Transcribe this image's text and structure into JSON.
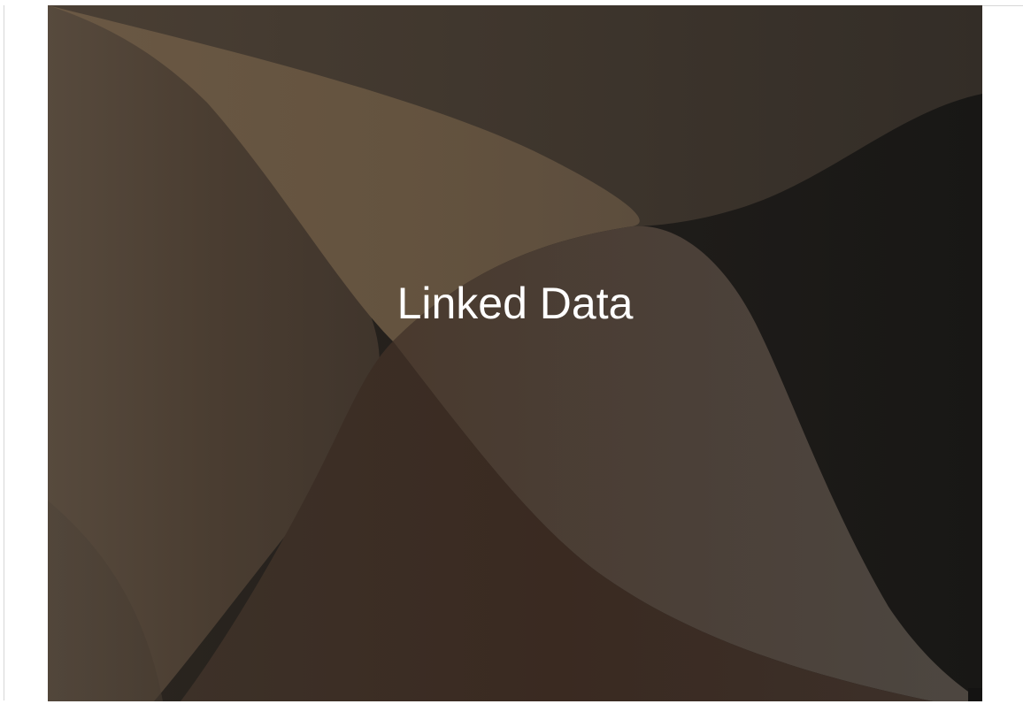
{
  "slide": {
    "title": "Linked Data"
  },
  "colors": {
    "background_dark": "#1b1a18",
    "upper_band": "#3c342c",
    "left_panel": "#4c4034",
    "center_light": "#65543f",
    "lower_center": "#3a2b22",
    "right_lower": "#4b443e",
    "title_text": "#ffffff"
  }
}
